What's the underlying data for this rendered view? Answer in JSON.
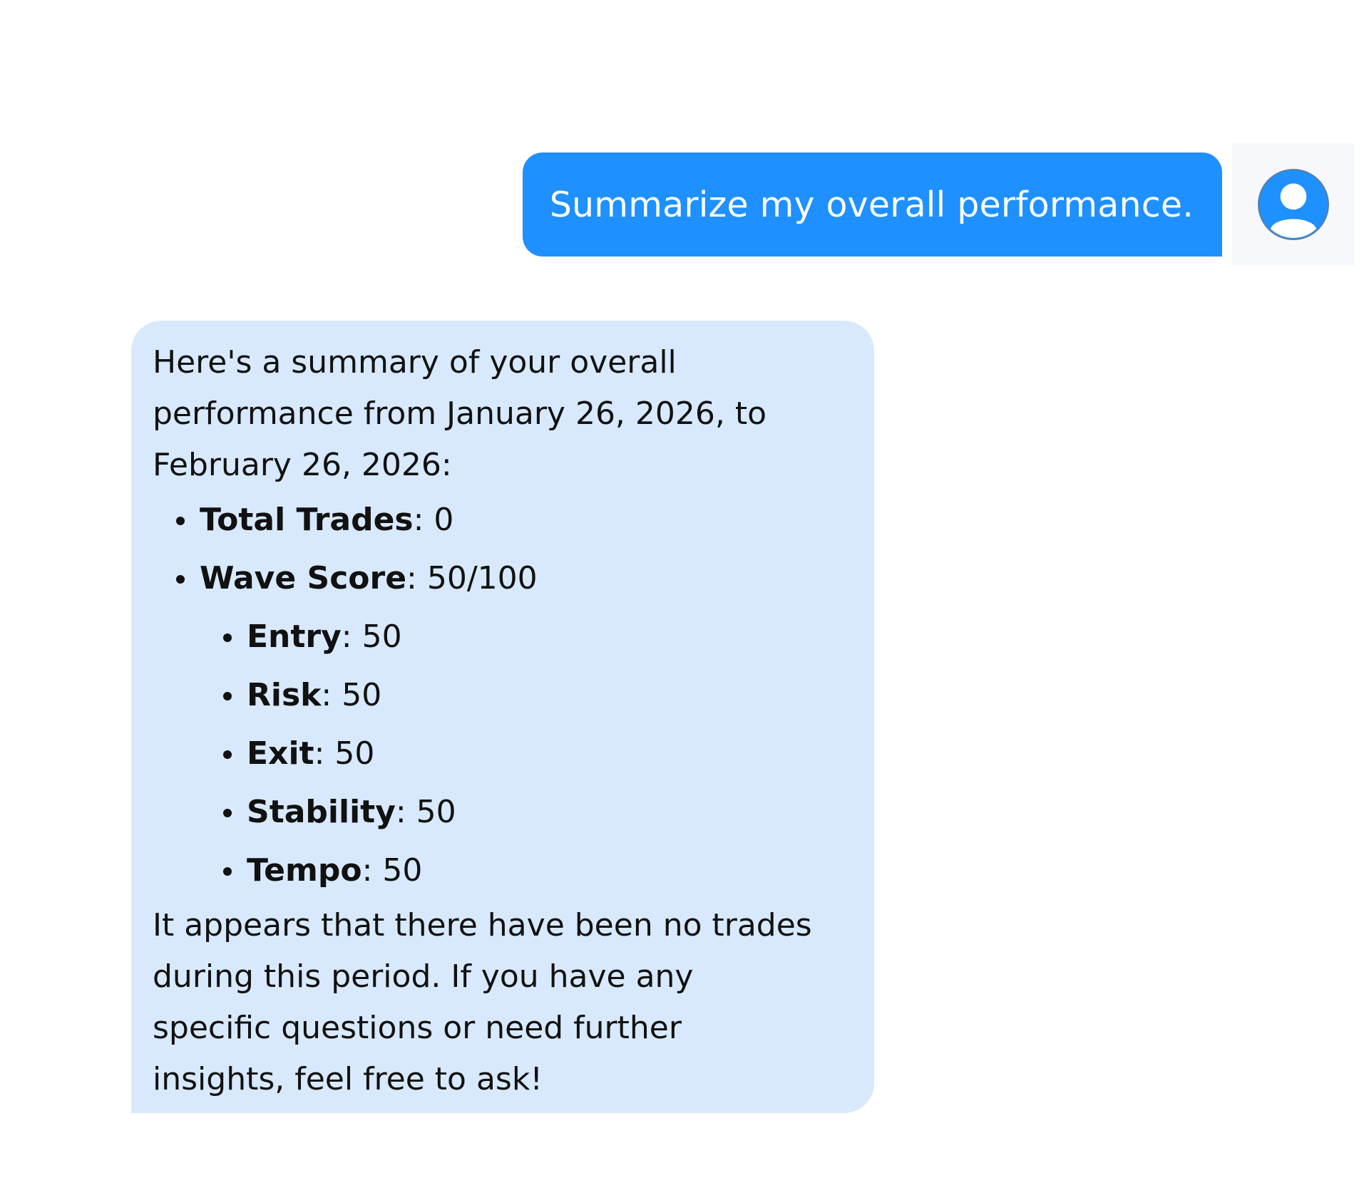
{
  "user_message": {
    "text": "Summarize my overall performance."
  },
  "assistant_message": {
    "intro": [
      "Here's a summary of your overall",
      "performance from January 26, 2026, to",
      "February 26, 2026:"
    ],
    "items": [
      {
        "label": "Total Trades",
        "value": ": 0"
      },
      {
        "label": "Wave Score",
        "value": ": 50/100"
      }
    ],
    "sub_items": [
      {
        "label": "Entry",
        "value": ": 50"
      },
      {
        "label": "Risk",
        "value": ": 50"
      },
      {
        "label": "Exit",
        "value": ": 50"
      },
      {
        "label": "Stability",
        "value": ": 50"
      },
      {
        "label": "Tempo",
        "value": ": 50"
      }
    ],
    "outro": [
      "It appears that there have been no trades",
      "during this period. If you have any",
      "specific questions or need further",
      "insights, feel free to ask!"
    ]
  },
  "colors": {
    "user_bubble": "#1e90ff",
    "assistant_bubble": "#d8e9fd",
    "avatar": "#1e90ff"
  },
  "icons": {
    "avatar": "user-avatar-icon"
  }
}
